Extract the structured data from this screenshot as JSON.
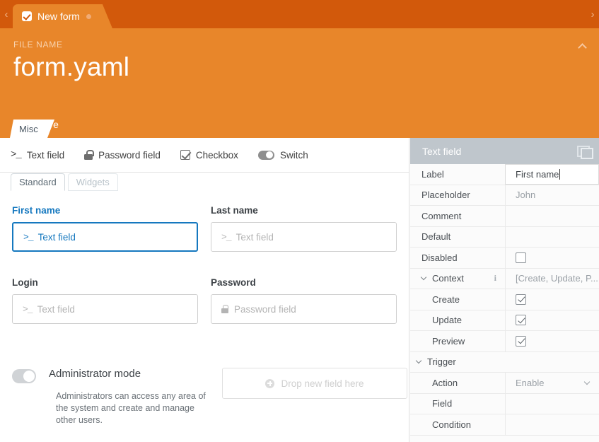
{
  "tabstrip": {
    "prev_arrow": "‹",
    "next_arrow": "›",
    "active_tab": {
      "label": "New form",
      "icon": "checkbox-checked-icon",
      "dirty_dot": true
    }
  },
  "header": {
    "caption": "FILE NAME",
    "filename": "form.yaml",
    "save_label": "Save",
    "collapse_icon": "chevron-up-icon",
    "misc_tab_label": "Misc",
    "background_color": "#e8862a",
    "tabstrip_color": "#d2590b"
  },
  "toolbar": {
    "items": [
      {
        "label": "Text field",
        "icon": "prompt-icon",
        "glyph": ">_"
      },
      {
        "label": "Password field",
        "icon": "lock-icon"
      },
      {
        "label": "Checkbox",
        "icon": "checkbox-icon"
      },
      {
        "label": "Switch",
        "icon": "switch-icon"
      }
    ]
  },
  "subtabs": [
    {
      "label": "Standard",
      "active": true
    },
    {
      "label": "Widgets",
      "active": false
    }
  ],
  "form": {
    "fields": [
      {
        "label": "First name",
        "placeholder": "Text field",
        "prefix": ">_",
        "type": "text",
        "selected": true
      },
      {
        "label": "Last name",
        "placeholder": "Text field",
        "prefix": ">_",
        "type": "text",
        "selected": false
      },
      {
        "label": "Login",
        "placeholder": "Text field",
        "prefix": ">_",
        "type": "text",
        "selected": false
      },
      {
        "label": "Password",
        "placeholder": "Password field",
        "type": "password",
        "selected": false
      }
    ],
    "admin": {
      "title": "Administrator mode",
      "description": "Administrators can access any area of the system and create and manage other users.",
      "switch_on": false
    },
    "dropzone": {
      "label": "Drop new field here",
      "icon": "plus-circle-icon"
    }
  },
  "properties": {
    "title": "Text field",
    "header_icon": "layers-icon",
    "accent_color": "#bfc6cc",
    "rows": [
      {
        "name": "Label",
        "value": "First name",
        "kind": "text-active"
      },
      {
        "name": "Placeholder",
        "value": "John",
        "kind": "text"
      },
      {
        "name": "Comment",
        "value": "",
        "kind": "text"
      },
      {
        "name": "Default",
        "value": "",
        "kind": "text"
      },
      {
        "name": "Disabled",
        "value": "",
        "kind": "checkbox",
        "checked": false
      },
      {
        "name": "Context",
        "value": "[Create, Update, P...",
        "kind": "group-value",
        "expanded": true,
        "info": true
      },
      {
        "name": "Create",
        "value": "",
        "kind": "checkbox",
        "checked": true,
        "indent": true
      },
      {
        "name": "Update",
        "value": "",
        "kind": "checkbox",
        "checked": true,
        "indent": true
      },
      {
        "name": "Preview",
        "value": "",
        "kind": "checkbox",
        "checked": true,
        "indent": true
      },
      {
        "name": "Trigger",
        "value": "",
        "kind": "group",
        "expanded": true
      },
      {
        "name": "Action",
        "value": "Enable",
        "kind": "select",
        "indent": true
      },
      {
        "name": "Field",
        "value": "",
        "kind": "text",
        "indent": true
      },
      {
        "name": "Condition",
        "value": "",
        "kind": "text",
        "indent": true
      }
    ]
  }
}
